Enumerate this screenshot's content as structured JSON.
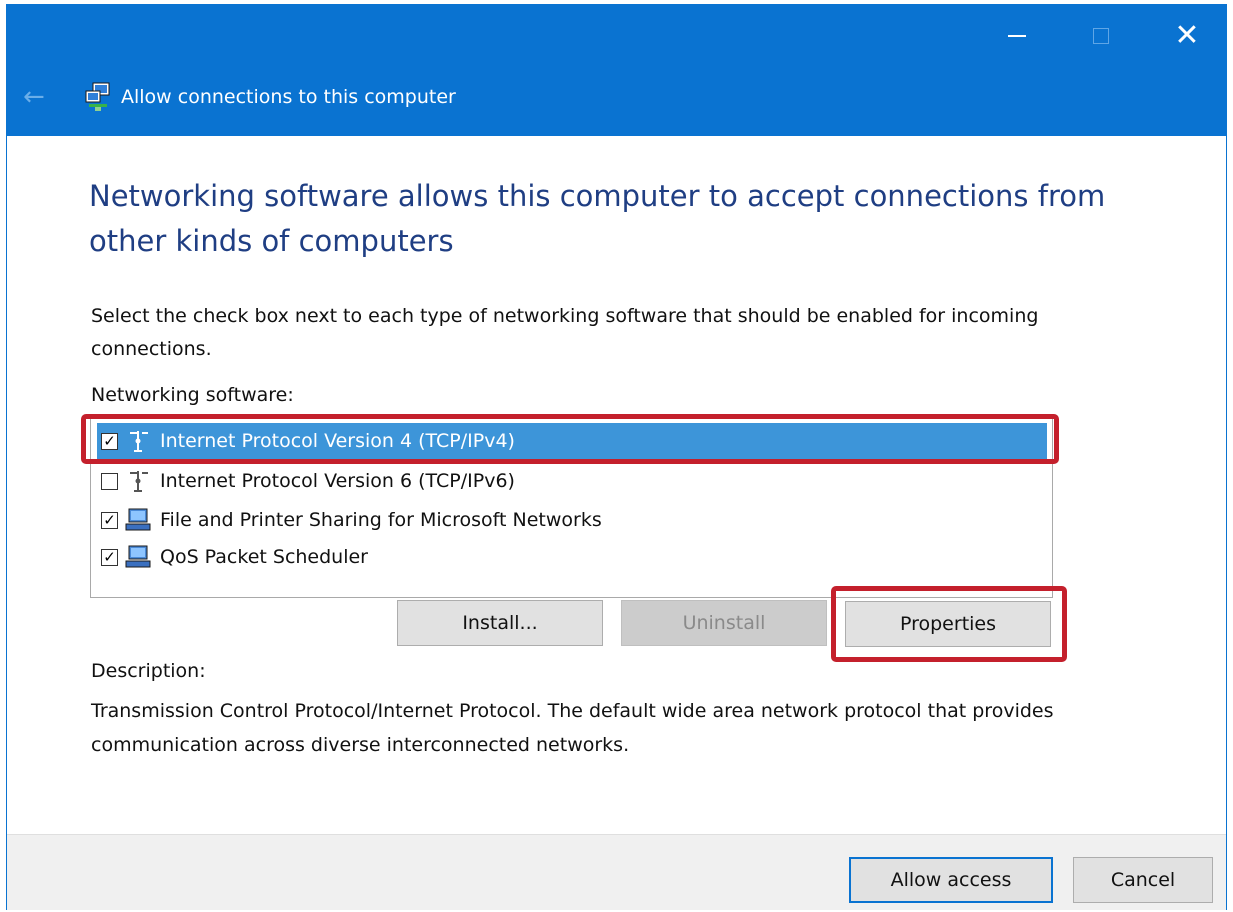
{
  "window": {
    "title": "Allow connections to this computer",
    "controls": {
      "minimize_icon": "minimize-icon",
      "maximize_icon": "maximize-icon",
      "close_icon": "close-icon"
    }
  },
  "heading": "Networking software allows this computer to accept connections from other kinds of computers",
  "instructions": "Select the check box next to each type of networking software that should be enabled for incoming connections.",
  "list": {
    "label": "Networking software:",
    "items": [
      {
        "label": "Internet Protocol Version 4 (TCP/IPv4)",
        "checked": true,
        "selected": true,
        "icon": "network-protocol-icon"
      },
      {
        "label": "Internet Protocol Version 6 (TCP/IPv6)",
        "checked": false,
        "selected": false,
        "icon": "network-protocol-icon"
      },
      {
        "label": "File and Printer Sharing for Microsoft Networks",
        "checked": true,
        "selected": false,
        "icon": "network-computer-icon"
      },
      {
        "label": "QoS Packet Scheduler",
        "checked": true,
        "selected": false,
        "icon": "network-computer-icon"
      }
    ]
  },
  "buttons": {
    "install": "Install...",
    "uninstall": "Uninstall",
    "properties": "Properties",
    "allow_access": "Allow access",
    "cancel": "Cancel"
  },
  "description": {
    "label": "Description:",
    "text": "Transmission Control Protocol/Internet Protocol. The default wide area network protocol that provides communication across diverse interconnected networks."
  },
  "colors": {
    "titlebar": "#0a73d1",
    "heading": "#1f3e83",
    "selection": "#3d95d9",
    "highlight_box": "#c4202c"
  }
}
